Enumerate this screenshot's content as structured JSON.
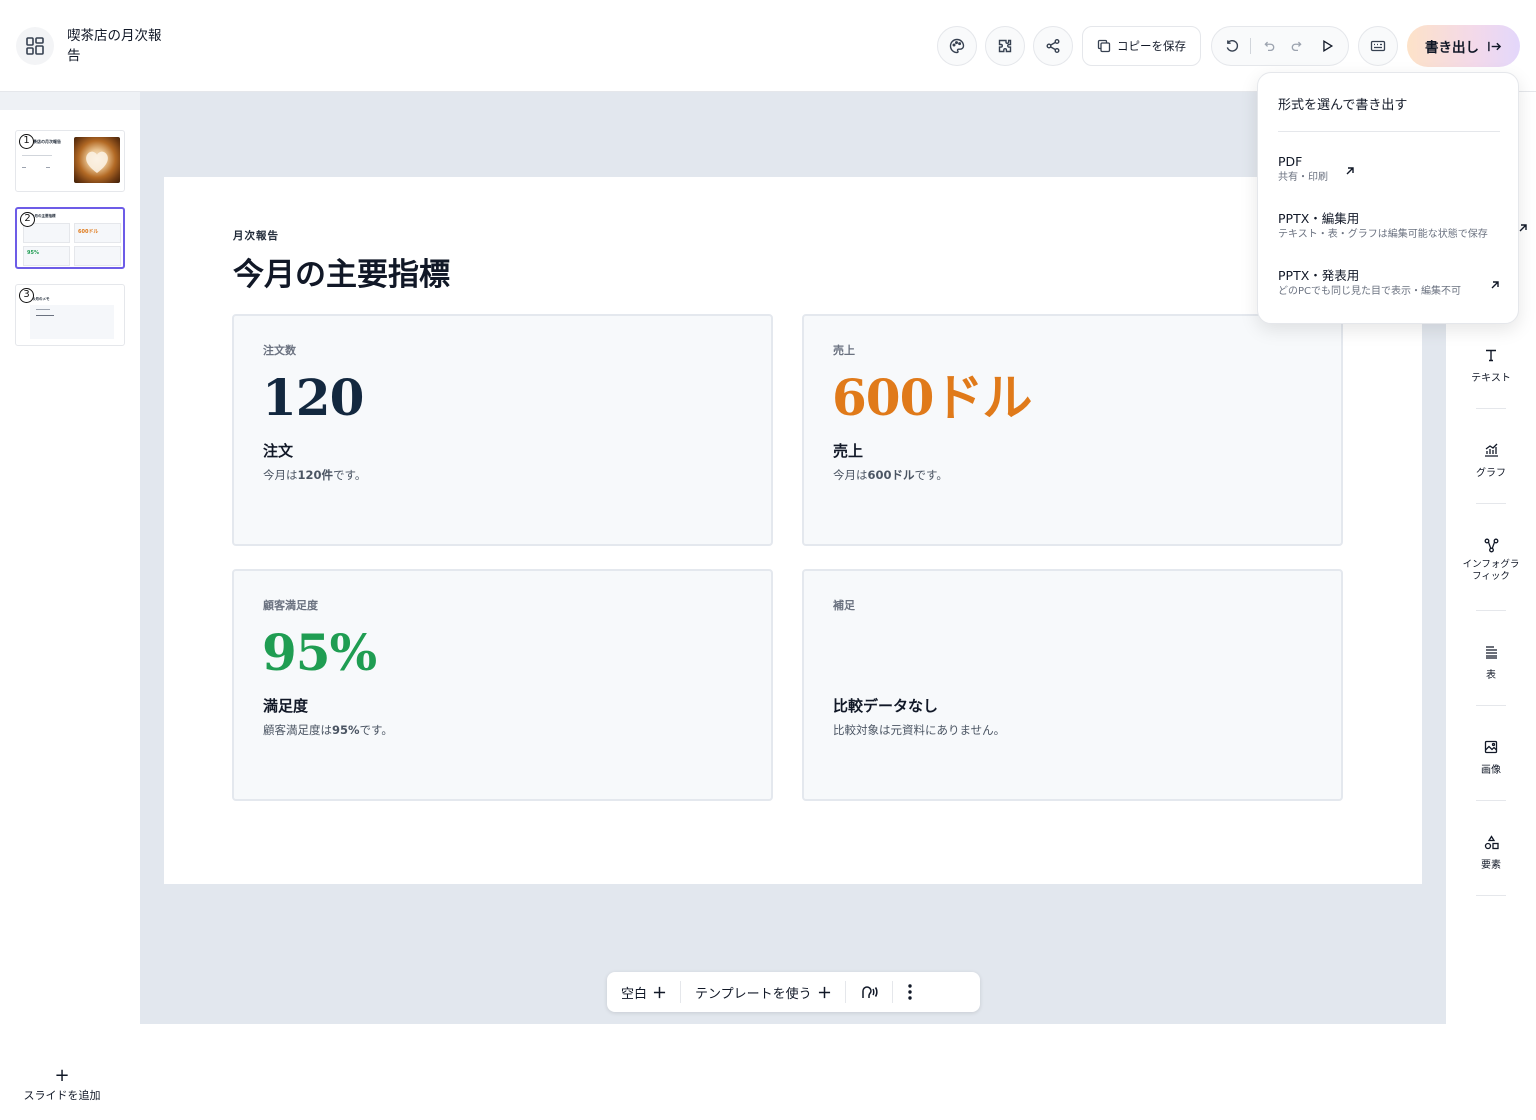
{
  "header": {
    "doc_title": "喫茶店の月次報告",
    "copy_button": "コピーを保存",
    "export_button": "書き出し"
  },
  "slides_panel": {
    "thumbnails": [
      {
        "number": "1",
        "title": "喫茶店の月次報告"
      },
      {
        "number": "2",
        "title": "今月の主要指標",
        "active": true
      },
      {
        "number": "3",
        "title": "今月のメモ"
      }
    ],
    "add_slide": "スライドを追加"
  },
  "slide": {
    "kicker": "月次報告",
    "title": "今月の主要指標",
    "cards": [
      {
        "label": "注文数",
        "value": "120",
        "value_color": "#13283f",
        "heading": "注文",
        "desc_prefix": "今月は",
        "desc_bold": "120件",
        "desc_suffix": "です。"
      },
      {
        "label": "売上",
        "value": "600ドル",
        "value_color": "#e07a1a",
        "heading": "売上",
        "desc_prefix": "今月は",
        "desc_bold": "600ドル",
        "desc_suffix": "です。"
      },
      {
        "label": "顧客満足度",
        "value": "95%",
        "value_color": "#1f9d52",
        "heading": "満足度",
        "desc_prefix": "顧客満足度は",
        "desc_bold": "95%",
        "desc_suffix": "です。"
      },
      {
        "label": "補足",
        "value": "",
        "value_color": "#13283f",
        "heading": "比較データなし",
        "desc_prefix": "比較対象は元資料にありません。",
        "desc_bold": "",
        "desc_suffix": ""
      }
    ]
  },
  "bottom_toolbar": {
    "blank": "空白",
    "template": "テンプレートを使う"
  },
  "tools": [
    {
      "label": "テキスト",
      "icon": "text-icon"
    },
    {
      "label": "グラフ",
      "icon": "chart-icon"
    },
    {
      "label": "インフォグラフィック",
      "icon": "infographic-icon"
    },
    {
      "label": "表",
      "icon": "table-icon"
    },
    {
      "label": "画像",
      "icon": "image-icon"
    },
    {
      "label": "要素",
      "icon": "elements-icon"
    }
  ],
  "export_menu": {
    "title": "形式を選んで書き出す",
    "options": [
      {
        "name": "PDF",
        "hint": "共有・印刷"
      },
      {
        "name": "PPTX・編集用",
        "hint": "テキスト・表・グラフは編集可能な状態で保存"
      },
      {
        "name": "PPTX・発表用",
        "hint": "どのPCでも同じ見た目で表示・編集不可"
      }
    ]
  },
  "colors": {
    "accent": "#6d5ce7",
    "canvas": "#e2e7ee"
  }
}
